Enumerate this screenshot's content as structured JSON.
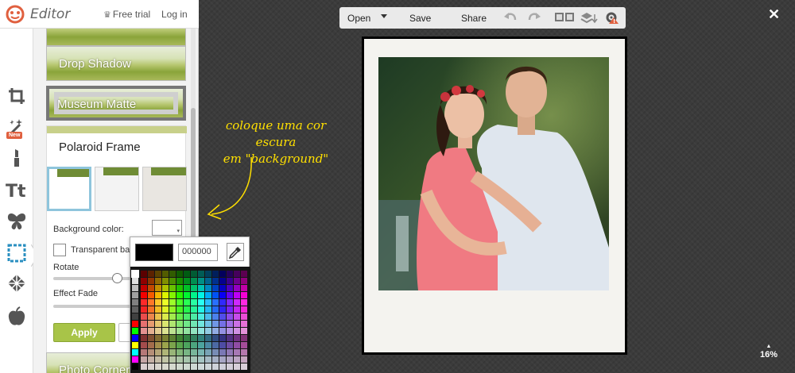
{
  "header": {
    "app_title": "Editor",
    "free_trial_label": "Free trial",
    "login_label": "Log in"
  },
  "left_toolbar": {
    "new_badge": "New",
    "tools": [
      "crop-icon",
      "magic-wand-icon",
      "lipstick-icon",
      "text-icon",
      "butterfly-icon",
      "frame-icon",
      "texture-icon",
      "apple-icon"
    ]
  },
  "effects_panel": {
    "effects": [
      "Drop Shadow",
      "Museum Matte",
      "Polaroid Frame",
      "Photo Corners"
    ],
    "background_color_label": "Background color:",
    "transparent_label": "Transparent ba",
    "rotate_label": "Rotate",
    "effect_fade_label": "Effect Fade",
    "apply_label": "Apply",
    "rotate_value": 0.5,
    "effect_fade_value": 0
  },
  "color_picker": {
    "hex_value": "000000",
    "preview_color": "#000000"
  },
  "annotation": {
    "line1": "coloque uma cor escura",
    "line2": "em \"background\""
  },
  "top_toolbar": {
    "open_label": "Open",
    "save_label": "Save",
    "share_label": "Share"
  },
  "zoom": {
    "level": "16%"
  },
  "colors": {
    "accent": "#a8c448",
    "annotation": "#ffe000",
    "badge": "#e0603f"
  }
}
